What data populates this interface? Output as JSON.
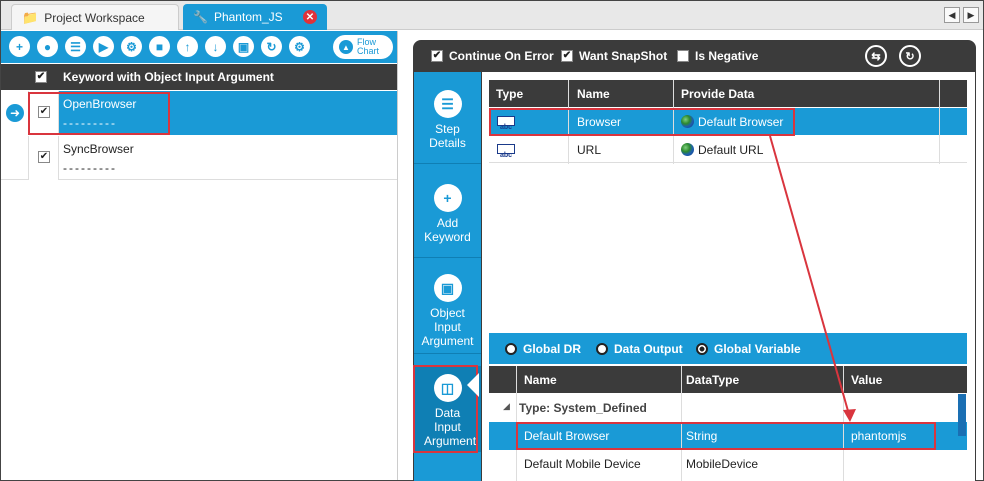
{
  "tabs": {
    "workspace": "Project Workspace",
    "phantom": "Phantom_JS"
  },
  "left": {
    "flow_chart_label": "Flow Chart",
    "header": "Keyword with Object Input Argument",
    "rows": [
      {
        "keyword": "OpenBrowser",
        "args": "---------"
      },
      {
        "keyword": "SyncBrowser",
        "args": "---------"
      }
    ]
  },
  "right": {
    "options": [
      "Continue On Error",
      "Want SnapShot",
      "Is Negative"
    ],
    "nav": [
      {
        "label": "Step Details"
      },
      {
        "label": "Add Keyword"
      },
      {
        "label": "Object Input Argument"
      },
      {
        "label": "Data Input Argument"
      }
    ],
    "table": {
      "headers": [
        "Type",
        "Name",
        "Provide Data"
      ],
      "rows": [
        {
          "type": "abc",
          "name": "Browser",
          "data": "Default Browser"
        },
        {
          "type": "abc",
          "name": "URL",
          "data": "Default URL"
        }
      ]
    },
    "radios": [
      "Global DR",
      "Data Output",
      "Global Variable"
    ],
    "vars": {
      "headers": [
        "Name",
        "DataType",
        "Value"
      ],
      "group": "Type: System_Defined",
      "rows": [
        {
          "name": "Default Browser",
          "type": "String",
          "value": "phantomjs"
        },
        {
          "name": "Default Mobile Device",
          "type": "MobileDevice",
          "value": ""
        }
      ]
    }
  }
}
